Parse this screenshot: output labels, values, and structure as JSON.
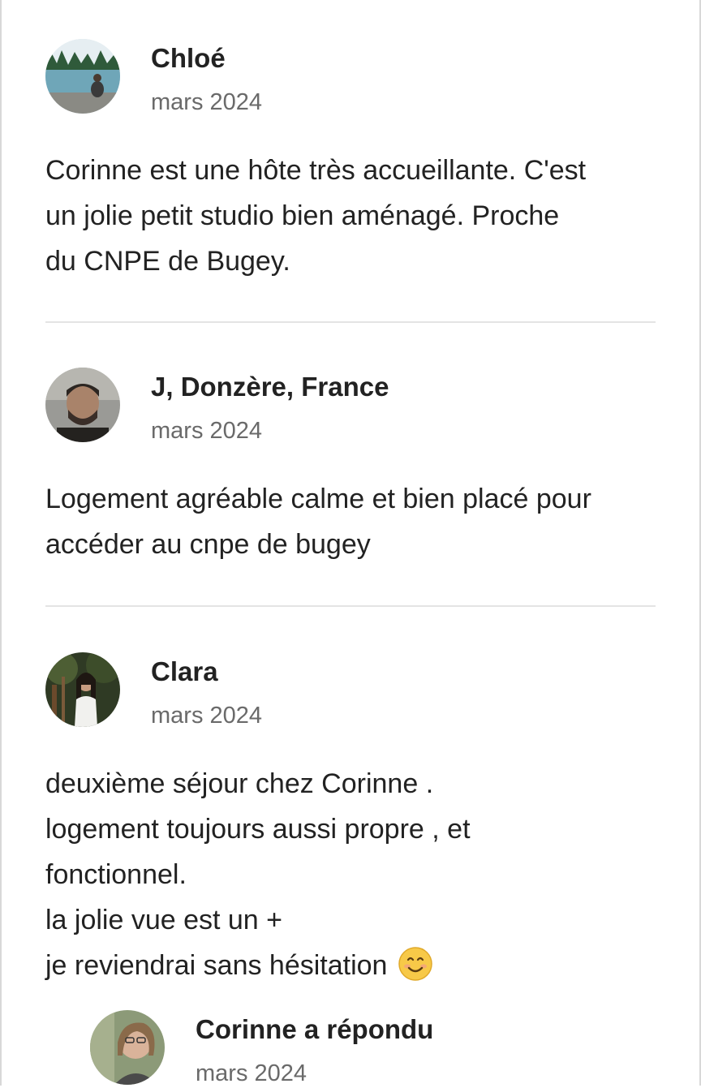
{
  "reviews": [
    {
      "name": "Chloé",
      "date": "mars 2024",
      "text": "Corinne est une hôte très accueillante. C'est\nun jolie petit studio bien aménagé. Proche\ndu CNPE de Bugey.",
      "avatar_icon": "lake-photo-avatar"
    },
    {
      "name": "J, Donzère, France",
      "date": "mars 2024",
      "text": "Logement agréable calme et bien placé pour\naccéder au cnpe de bugey",
      "avatar_icon": "man-photo-avatar"
    },
    {
      "name": "Clara",
      "date": "mars 2024",
      "text_lines": [
        "deuxième séjour chez Corinne .",
        "logement toujours aussi propre , et",
        "fonctionnel.",
        "la jolie vue est un +",
        "je reviendrai sans hésitation"
      ],
      "emoji": "smiling-face-emoji",
      "avatar_icon": "woman-forest-photo-avatar"
    }
  ],
  "reply": {
    "name": "Corinne a répondu",
    "date": "mars 2024",
    "avatar_icon": "host-photo-avatar"
  },
  "colors": {
    "text": "#222222",
    "secondary_text": "#6a6a6a",
    "divider": "#e4e4e4",
    "emoji": "#f7c948"
  }
}
